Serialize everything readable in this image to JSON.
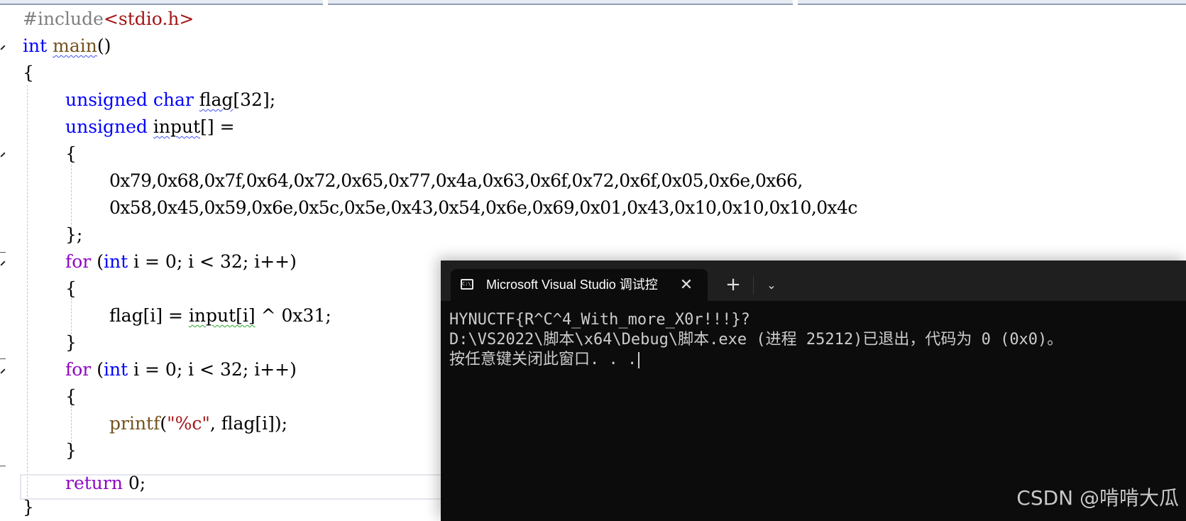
{
  "editor": {
    "line1": {
      "inc": "#include",
      "hdr": "<stdio.h>"
    },
    "line2": {
      "kw": "int",
      "fn": "main",
      "rest": "()"
    },
    "line3": "{",
    "line4": {
      "kw": "unsigned char",
      "var": "flag",
      "rest": "[32];"
    },
    "line5": {
      "kw": "unsigned",
      "var": "input",
      "rest": "[] ="
    },
    "line6": "{",
    "line7": "0x79,0x68,0x7f,0x64,0x72,0x65,0x77,0x4a,0x63,0x6f,0x72,0x6f,0x05,0x6e,0x66,",
    "line8": "0x58,0x45,0x59,0x6e,0x5c,0x5e,0x43,0x54,0x6e,0x69,0x01,0x43,0x10,0x10,0x10,0x4c",
    "line9": "};",
    "line10": {
      "kw": "for",
      "p1": " (",
      "kw2": "int",
      "rest": " i = 0; i < 32; i++)"
    },
    "line11": "{",
    "line12": {
      "a": "flag[i] = ",
      "b": "input[i]",
      "c": " ^ 0x31;"
    },
    "line13": "}",
    "line14": {
      "kw": "for",
      "p1": " (",
      "kw2": "int",
      "rest": " i = 0; i < 32; i++)"
    },
    "line15": "{",
    "line16": {
      "fn": "printf",
      "p1": "(",
      "str": "\"%c\"",
      "rest": ", flag[i]);"
    },
    "line17": "}",
    "line18": {
      "kw": "return",
      "rest": " 0;"
    },
    "line19": "}"
  },
  "terminal": {
    "tab_title": "Microsoft Visual Studio 调试控",
    "tab_icon": "console-icon",
    "close_glyph": "✕",
    "new_tab_glyph": "+",
    "dropdown_glyph": "⌄",
    "output": [
      "HYNUCTF{R^C^4_With_more_X0r!!!}?",
      "D:\\VS2022\\脚本\\x64\\Debug\\脚本.exe (进程 25212)已退出，代码为 0 (0x0)。",
      "按任意键关闭此窗口. . ."
    ]
  },
  "watermark": "CSDN @啃啃大瓜",
  "colors": {
    "keyword": "#0000ff",
    "control_keyword": "#8f08c4",
    "function": "#74531f",
    "string": "#a31515",
    "terminal_bg": "#0c0c0c",
    "terminal_text": "#cccccc"
  }
}
